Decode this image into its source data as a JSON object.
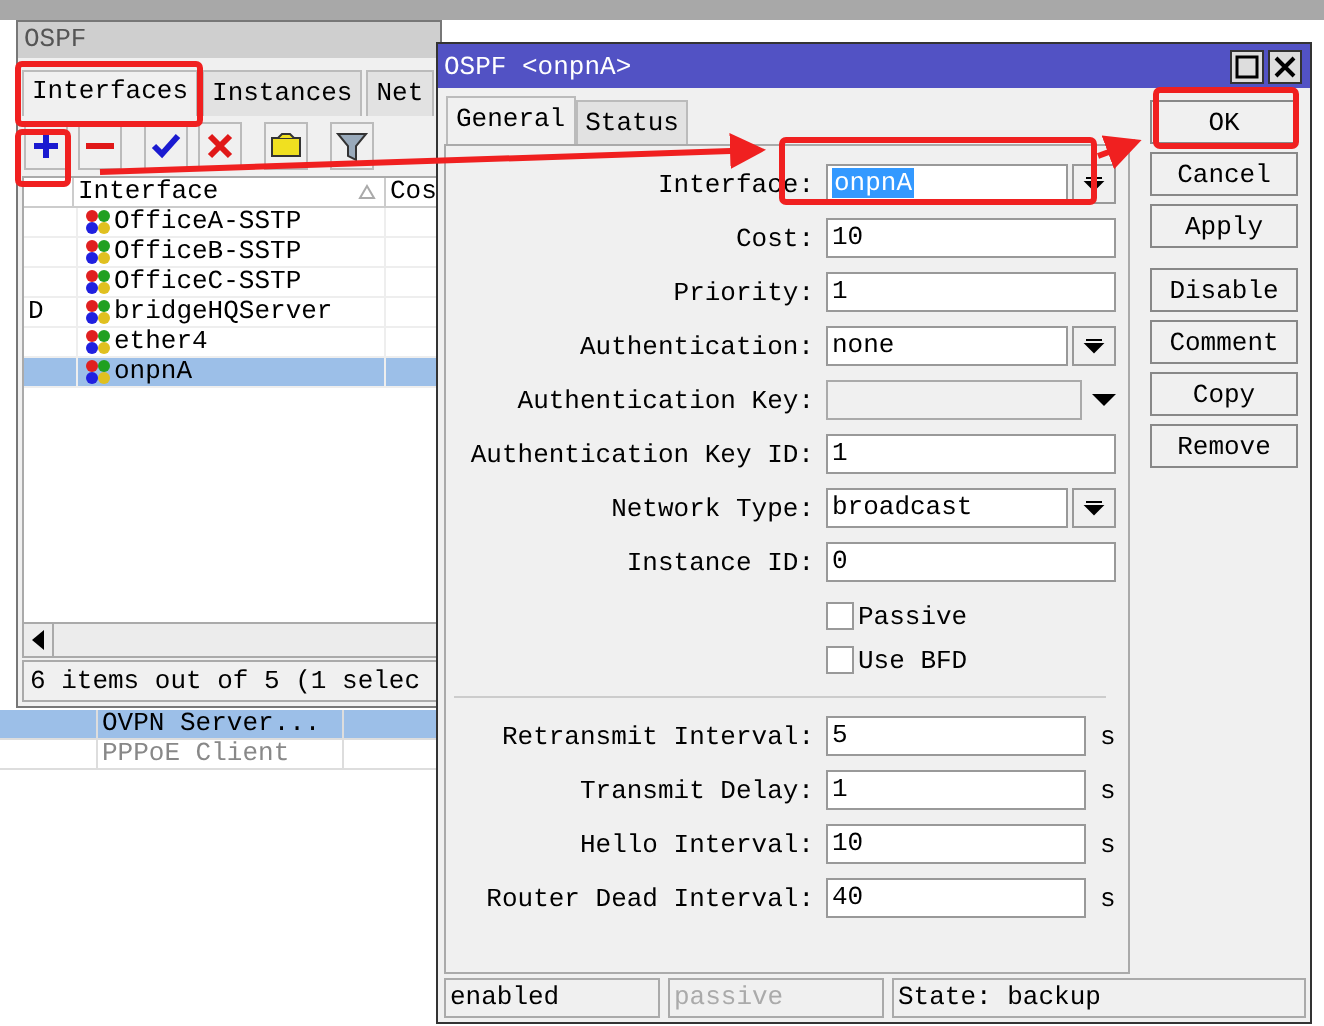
{
  "background_list": {
    "rows": [
      {
        "name": "OVPN Server...",
        "selected": true,
        "disabled": false
      },
      {
        "name": "PPPoE Client",
        "selected": false,
        "disabled": true
      }
    ]
  },
  "ospf_window": {
    "title": "OSPF",
    "tabs": [
      {
        "label": "Interfaces",
        "selected": true
      },
      {
        "label": "Instances",
        "selected": false
      },
      {
        "label": "Net",
        "selected": false
      }
    ],
    "toolbar": [
      {
        "kind": "add"
      },
      {
        "kind": "remove"
      },
      {
        "kind": "enable"
      },
      {
        "kind": "disable"
      },
      {
        "kind": "comment"
      },
      {
        "kind": "filter"
      }
    ],
    "table": {
      "columns": [
        "Interface",
        "Cos"
      ],
      "rows": [
        {
          "flag": "",
          "interface": "OfficeA-SSTP",
          "selected": false
        },
        {
          "flag": "",
          "interface": "OfficeB-SSTP",
          "selected": false
        },
        {
          "flag": "",
          "interface": "OfficeC-SSTP",
          "selected": false
        },
        {
          "flag": "D",
          "interface": "bridgeHQServer",
          "selected": false
        },
        {
          "flag": "",
          "interface": "ether4",
          "selected": false
        },
        {
          "flag": "",
          "interface": "onpnA",
          "selected": true
        }
      ]
    },
    "status": "6 items out of 5 (1 selec"
  },
  "dialog": {
    "title": "OSPF <onpnA>",
    "tabs": [
      {
        "label": "General",
        "selected": true
      },
      {
        "label": "Status",
        "selected": false
      }
    ],
    "fields": [
      {
        "kind": "select",
        "label": "Interface:",
        "value": "onpnA",
        "selected": true
      },
      {
        "kind": "text",
        "label": "Cost:",
        "value": "10"
      },
      {
        "kind": "text",
        "label": "Priority:",
        "value": "1"
      },
      {
        "kind": "select",
        "label": "Authentication:",
        "value": "none",
        "selected": false
      },
      {
        "kind": "keyselect",
        "label": "Authentication Key:"
      },
      {
        "kind": "text",
        "label": "Authentication Key ID:",
        "value": "1"
      },
      {
        "kind": "select",
        "label": "Network Type:",
        "value": "broadcast",
        "selected": false
      },
      {
        "kind": "text",
        "label": "Instance ID:",
        "value": "0"
      },
      {
        "kind": "checkbox",
        "label": "Passive",
        "checked": false
      },
      {
        "kind": "checkbox",
        "label": "Use BFD",
        "checked": false
      },
      {
        "kind": "separator"
      },
      {
        "kind": "duration",
        "label": "Retransmit Interval:",
        "value": "5",
        "unit": "s"
      },
      {
        "kind": "duration",
        "label": "Transmit Delay:",
        "value": "1",
        "unit": "s"
      },
      {
        "kind": "duration",
        "label": "Hello Interval:",
        "value": "10",
        "unit": "s"
      },
      {
        "kind": "duration",
        "label": "Router Dead Interval:",
        "value": "40",
        "unit": "s"
      }
    ],
    "button_groups": [
      {
        "buttons": [
          "OK",
          "Cancel",
          "Apply"
        ]
      },
      {
        "buttons": [
          "Disable",
          "Comment",
          "Copy",
          "Remove"
        ]
      }
    ],
    "status_bar": [
      {
        "text": "enabled",
        "disabled": false
      },
      {
        "text": "passive",
        "disabled": true
      },
      {
        "text": "State: backup",
        "disabled": false
      }
    ]
  }
}
